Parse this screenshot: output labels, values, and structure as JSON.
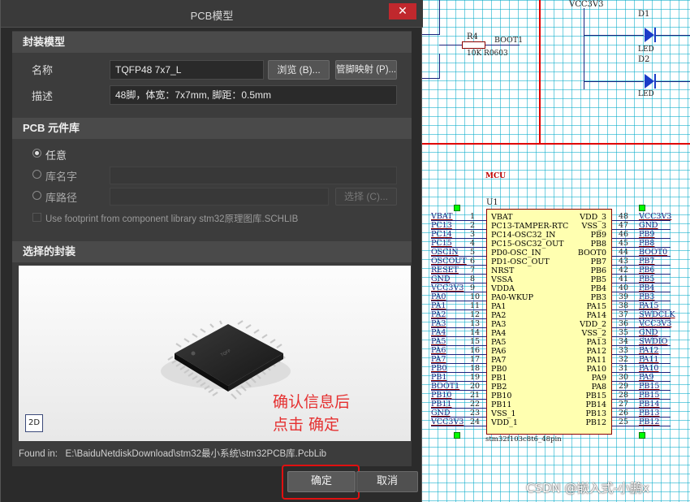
{
  "dialog": {
    "title": "PCB模型",
    "close_symbol": "✕",
    "section_footprint": "封装模型",
    "name_label": "名称",
    "name_value": "TQFP48 7x7_L",
    "browse_button": "浏览 (B)...",
    "pinmap_button": "管脚映射 (P)...",
    "desc_label": "描述",
    "desc_value": "48脚，体宽：7x7mm, 脚距：0.5mm",
    "section_library": "PCB 元件库",
    "radio_any": "任意",
    "radio_libname": "库名字",
    "radio_libpath": "库路径",
    "select_button": "选择 (C)...",
    "use_footprint_checkbox": "Use footprint from component library stm32原理图库.SCHLIB",
    "section_selected": "选择的封装",
    "badge_2d": "2D",
    "annotation_line1": "确认信息后",
    "annotation_line2": "点击 确定",
    "found_in_label": "Found in:",
    "found_in_path": "E:\\BaiduNetdiskDownload\\stm32最小系统\\stm32PCB库.PcbLib",
    "ok_button": "确定",
    "cancel_button": "取消"
  },
  "schematic": {
    "vcc_top": "VCC3V3",
    "d1": "D1",
    "d2": "D2",
    "led1": "LED",
    "led2": "LED",
    "r4": "R4",
    "r4_value": "10K R0603",
    "boot1": "BOOT1",
    "mcu_title": "MCU",
    "designator": "U1",
    "part_name": "stm32f103c8t6_48pin",
    "left_pins": [
      {
        "net": "VBAT",
        "num": "1",
        "name": "VBAT"
      },
      {
        "net": "PC13",
        "num": "2",
        "name": "PC13-TAMPER-RTC"
      },
      {
        "net": "PC14",
        "num": "3",
        "name": "PC14-OSC32_IN"
      },
      {
        "net": "PC15",
        "num": "4",
        "name": "PC15-OSC32_OUT"
      },
      {
        "net": "OSCIN",
        "num": "5",
        "name": "PD0-OSC_IN"
      },
      {
        "net": "OSCOUT",
        "num": "6",
        "name": "PD1-OSC_OUT"
      },
      {
        "net": "RESET",
        "num": "7",
        "name": "NRST"
      },
      {
        "net": "GND",
        "num": "8",
        "name": "VSSA"
      },
      {
        "net": "VCC3V3",
        "num": "9",
        "name": "VDDA"
      },
      {
        "net": "PA0",
        "num": "10",
        "name": "PA0-WKUP"
      },
      {
        "net": "PA1",
        "num": "11",
        "name": "PA1"
      },
      {
        "net": "PA2",
        "num": "12",
        "name": "PA2"
      },
      {
        "net": "PA3",
        "num": "13",
        "name": "PA3"
      },
      {
        "net": "PA4",
        "num": "14",
        "name": "PA4"
      },
      {
        "net": "PA5",
        "num": "15",
        "name": "PA5"
      },
      {
        "net": "PA6",
        "num": "16",
        "name": "PA6"
      },
      {
        "net": "PA7",
        "num": "17",
        "name": "PA7"
      },
      {
        "net": "PB0",
        "num": "18",
        "name": "PB0"
      },
      {
        "net": "PB1",
        "num": "19",
        "name": "PB1"
      },
      {
        "net": "BOOT1",
        "num": "20",
        "name": "PB2"
      },
      {
        "net": "PB10",
        "num": "21",
        "name": "PB10"
      },
      {
        "net": "PB11",
        "num": "22",
        "name": "PB11"
      },
      {
        "net": "GND",
        "num": "23",
        "name": "VSS_1"
      },
      {
        "net": "VCC3V3",
        "num": "24",
        "name": "VDD_1"
      }
    ],
    "right_pins": [
      {
        "net": "VCC3V3",
        "num": "48",
        "name": "VDD_3"
      },
      {
        "net": "GND",
        "num": "47",
        "name": "VSS_3"
      },
      {
        "net": "PB9",
        "num": "46",
        "name": "PB9"
      },
      {
        "net": "PB8",
        "num": "45",
        "name": "PB8"
      },
      {
        "net": "BOOT0",
        "num": "44",
        "name": "BOOT0"
      },
      {
        "net": "PB7",
        "num": "43",
        "name": "PB7"
      },
      {
        "net": "PB6",
        "num": "42",
        "name": "PB6"
      },
      {
        "net": "PB5",
        "num": "41",
        "name": "PB5"
      },
      {
        "net": "PB4",
        "num": "40",
        "name": "PB4"
      },
      {
        "net": "PB3",
        "num": "39",
        "name": "PB3"
      },
      {
        "net": "PA15",
        "num": "38",
        "name": "PA15"
      },
      {
        "net": "SWDCLK",
        "num": "37",
        "name": "PA14"
      },
      {
        "net": "VCC3V3",
        "num": "36",
        "name": "VDD_2"
      },
      {
        "net": "GND",
        "num": "35",
        "name": "VSS_2"
      },
      {
        "net": "SWDIO",
        "num": "34",
        "name": "PA13"
      },
      {
        "net": "PA12",
        "num": "33",
        "name": "PA12"
      },
      {
        "net": "PA11",
        "num": "32",
        "name": "PA11"
      },
      {
        "net": "PA10",
        "num": "31",
        "name": "PA10"
      },
      {
        "net": "PA9",
        "num": "30",
        "name": "PA9"
      },
      {
        "net": "PB15",
        "num": "29",
        "name": "PA8"
      },
      {
        "net": "PB15",
        "num": "28",
        "name": "PB15"
      },
      {
        "net": "PB14",
        "num": "27",
        "name": "PB14"
      },
      {
        "net": "PB13",
        "num": "26",
        "name": "PB13"
      },
      {
        "net": "PB12",
        "num": "25",
        "name": "PB12"
      }
    ]
  },
  "watermark": "CSDN @嵌入式-小鹏x",
  "colors": {
    "dialog_bg": "#2b2b2b",
    "section_bg": "#4a4a4a",
    "close_red": "#c0282d",
    "highlight_red": "#e01010",
    "chip_fill": "#ffffb0",
    "grid_cyan": "#00aac8"
  }
}
